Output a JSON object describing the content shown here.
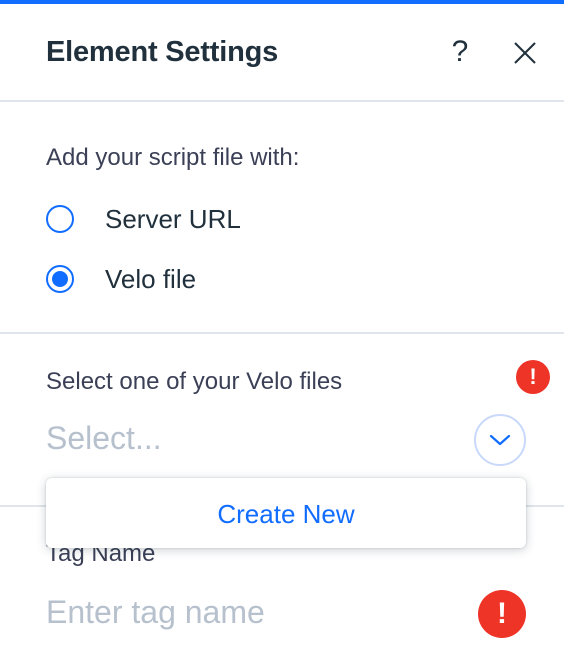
{
  "theme": {
    "accent": "#116dff",
    "error": "#ee3327",
    "divider": "#dfe5eb",
    "placeholder": "#b6c1cd"
  },
  "header": {
    "title": "Element Settings",
    "help_label": "?",
    "help_icon": "question-mark-icon",
    "close_icon": "close-icon"
  },
  "script_source": {
    "label": "Add your script file with:",
    "options": [
      {
        "label": "Server URL",
        "checked": false
      },
      {
        "label": "Velo file",
        "checked": true
      }
    ]
  },
  "velo_file": {
    "label": "Select one of your Velo files",
    "placeholder": "Select...",
    "error_glyph": "!",
    "dropdown_icon": "chevron-down-icon",
    "menu": {
      "items": [
        {
          "label": "Create New"
        }
      ]
    }
  },
  "tag_name": {
    "label": "Tag Name",
    "placeholder": "Enter tag name",
    "error_glyph": "!"
  }
}
